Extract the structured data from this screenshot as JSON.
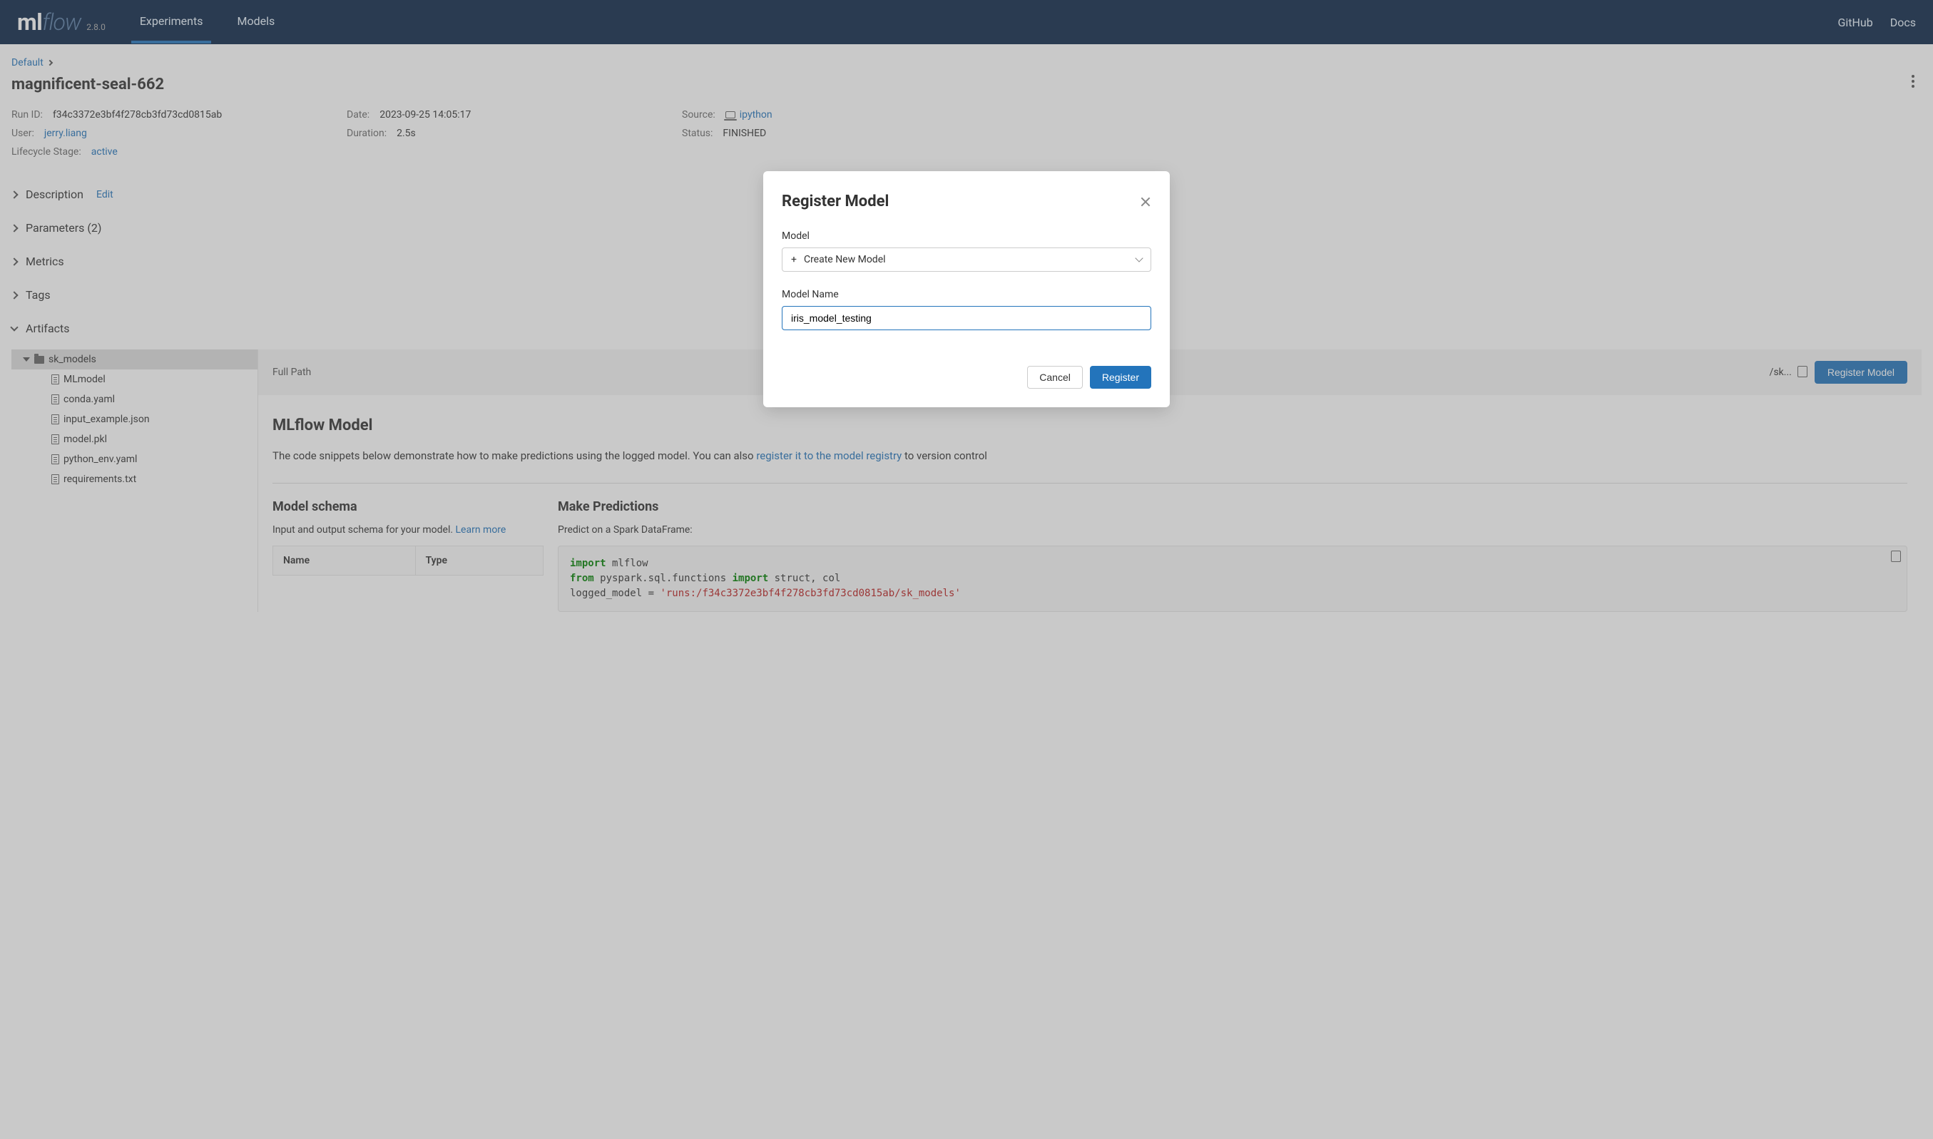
{
  "header": {
    "version": "2.8.0",
    "nav": {
      "experiments": "Experiments",
      "models": "Models"
    },
    "links": {
      "github": "GitHub",
      "docs": "Docs"
    }
  },
  "breadcrumb": {
    "root": "Default"
  },
  "page": {
    "title": "magnificent-seal-662"
  },
  "meta": {
    "run_id_label": "Run ID:",
    "run_id": "f34c3372e3bf4f278cb3fd73cd0815ab",
    "date_label": "Date:",
    "date": "2023-09-25 14:05:17",
    "source_label": "Source:",
    "source": "ipython",
    "user_label": "User:",
    "user": "jerry.liang",
    "duration_label": "Duration:",
    "duration": "2.5s",
    "status_label": "Status:",
    "status": "FINISHED",
    "lifecycle_label": "Lifecycle Stage:",
    "lifecycle": "active"
  },
  "sections": {
    "description": "Description",
    "description_edit": "Edit",
    "parameters": "Parameters (2)",
    "metrics": "Metrics",
    "tags": "Tags",
    "artifacts": "Artifacts"
  },
  "tree": {
    "root": "sk_models",
    "files": [
      "MLmodel",
      "conda.yaml",
      "input_example.json",
      "model.pkl",
      "python_env.yaml",
      "requirements.txt"
    ]
  },
  "artifact_header": {
    "fullpath_label": "Full Path",
    "fullpath_value": "/sk...",
    "register_button": "Register Model"
  },
  "artifact_body": {
    "title": "MLflow Model",
    "desc_prefix": "The code snippets below demonstrate how to make predictions using the logged model. You can also ",
    "desc_link": "register it to the model registry",
    "desc_suffix": " to version control",
    "schema_title": "Model schema",
    "schema_sub_prefix": "Input and output schema for your model. ",
    "schema_learn_more": "Learn more",
    "col_name": "Name",
    "col_type": "Type",
    "predictions_title": "Make Predictions",
    "predictions_sub": "Predict on a Spark DataFrame:",
    "code": {
      "l1a": "import",
      "l1b": " mlflow",
      "l2a": "from",
      "l2b": " pyspark.sql.functions ",
      "l2c": "import",
      "l2d": " struct, col",
      "l3a": "logged_model = ",
      "l3b": "'runs:/f34c3372e3bf4f278cb3fd73cd0815ab/sk_models'"
    }
  },
  "modal": {
    "title": "Register Model",
    "model_label": "Model",
    "select_value": "Create New Model",
    "name_label": "Model Name",
    "name_value": "iris_model_testing",
    "cancel": "Cancel",
    "register": "Register"
  }
}
